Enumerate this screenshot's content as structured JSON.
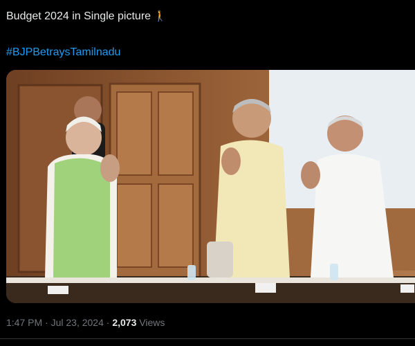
{
  "post": {
    "text": "Budget 2024 in Single picture",
    "emoji": "🚶",
    "hashtag": "#BJPBetraysTamilnadu",
    "meta": {
      "time": "1:47 PM",
      "date": "Jul 23, 2024",
      "separator": "·",
      "views_count": "2,073",
      "views_label": "Views"
    }
  },
  "media": {
    "icon": "photo-icon"
  },
  "colors": {
    "background": "#000000",
    "text": "#e7e9ea",
    "link": "#1d9bf0",
    "muted": "#71767b",
    "divider": "#2f3336"
  }
}
